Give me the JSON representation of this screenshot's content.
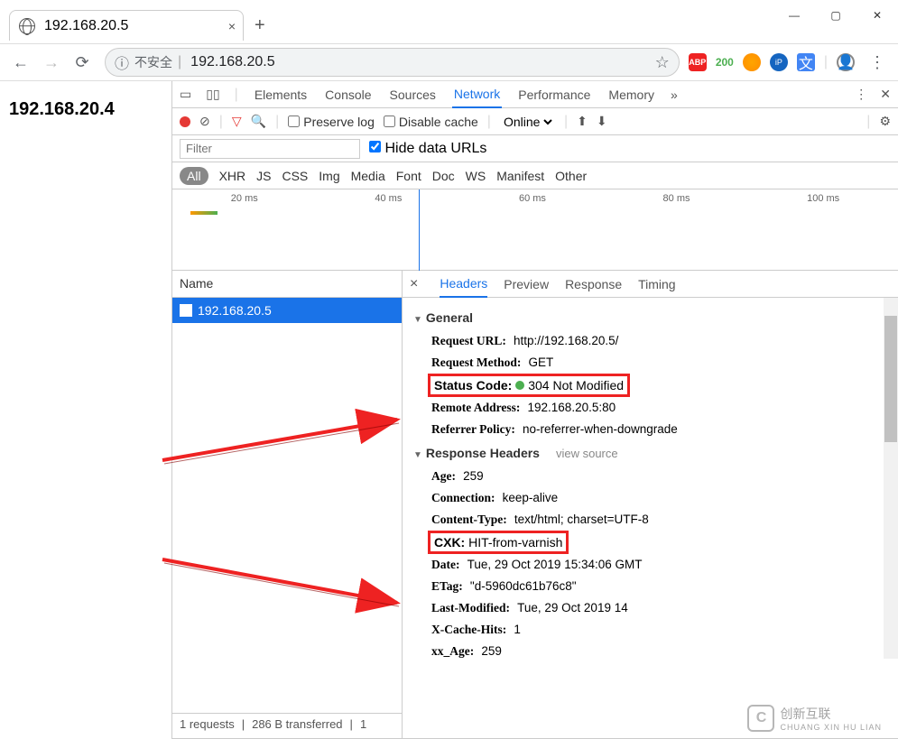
{
  "browser": {
    "tab_title": "192.168.20.5",
    "url_warning": "不安全",
    "url": "192.168.20.5",
    "ext_count": "200"
  },
  "page": {
    "body_text": "192.168.20.4"
  },
  "devtools": {
    "tabs": [
      "Elements",
      "Console",
      "Sources",
      "Network",
      "Performance",
      "Memory"
    ],
    "active_tab": "Network",
    "preserve_log": "Preserve log",
    "disable_cache": "Disable cache",
    "throttling": "Online",
    "filter_placeholder": "Filter",
    "hide_data_urls": "Hide data URLs",
    "types": [
      "All",
      "XHR",
      "JS",
      "CSS",
      "Img",
      "Media",
      "Font",
      "Doc",
      "WS",
      "Manifest",
      "Other"
    ],
    "timeline_marks": [
      "20 ms",
      "40 ms",
      "60 ms",
      "80 ms",
      "100 ms"
    ],
    "name_header": "Name",
    "request_item": "192.168.20.5",
    "footer_requests": "1 requests",
    "footer_transferred": "286 B transferred",
    "footer_extra": "1",
    "detail_tabs": [
      "Headers",
      "Preview",
      "Response",
      "Timing"
    ],
    "sections": {
      "general": "General",
      "response_headers": "Response Headers",
      "view_source": "view source"
    },
    "general": {
      "request_url_label": "Request URL:",
      "request_url": "http://192.168.20.5/",
      "request_method_label": "Request Method:",
      "request_method": "GET",
      "status_code_label": "Status Code:",
      "status_code": "304 Not Modified",
      "remote_addr_label": "Remote Address:",
      "remote_addr": "192.168.20.5:80",
      "referrer_label": "Referrer Policy:",
      "referrer": "no-referrer-when-downgrade"
    },
    "response_headers": {
      "age_label": "Age:",
      "age": "259",
      "connection_label": "Connection:",
      "connection": "keep-alive",
      "content_type_label": "Content-Type:",
      "content_type": "text/html; charset=UTF-8",
      "cxk_label": "CXK:",
      "cxk": "HIT-from-varnish",
      "date_label": "Date:",
      "date": "Tue, 29 Oct 2019 15:34:06 GMT",
      "etag_label": "ETag:",
      "etag": "\"d-5960dc61b76c8\"",
      "last_modified_label": "Last-Modified:",
      "last_modified": "Tue, 29 Oct 2019 14",
      "x_cache_hits_label": "X-Cache-Hits:",
      "x_cache_hits": "1",
      "xx_age_label": "xx_Age:",
      "xx_age": "259"
    }
  },
  "watermark": {
    "logo": "C",
    "text": "创新互联",
    "sub": "CHUANG XIN HU LIAN"
  }
}
